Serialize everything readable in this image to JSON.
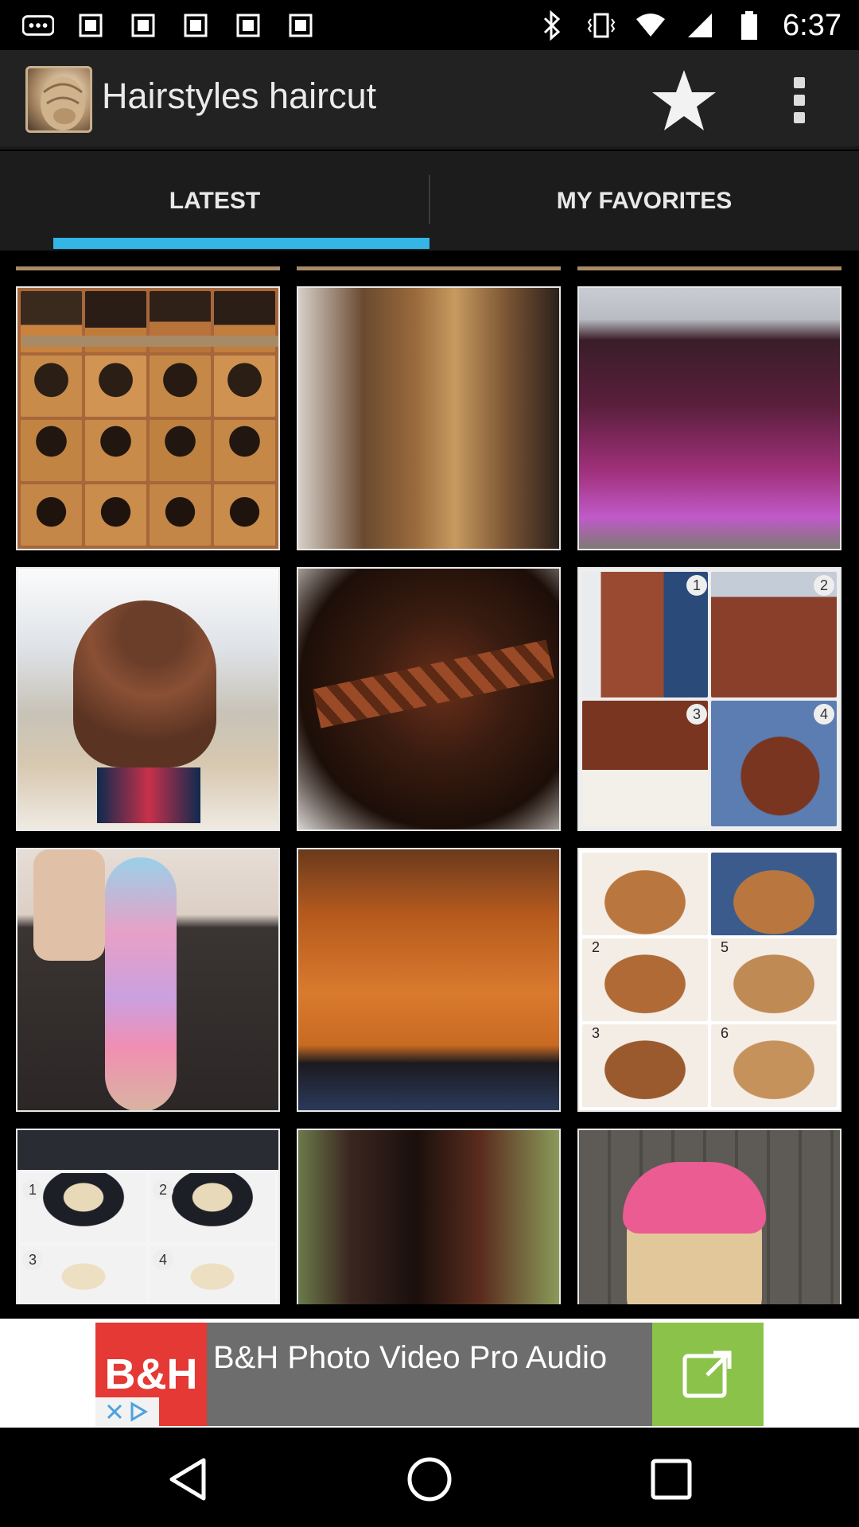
{
  "status_bar": {
    "time": "6:37",
    "left_icons": [
      "more-notifications-icon",
      "image-icon",
      "image-icon",
      "image-icon",
      "image-icon",
      "image-icon"
    ],
    "right_icons": [
      "bluetooth-icon",
      "vibrate-icon",
      "wifi-icon",
      "signal-icon",
      "battery-icon"
    ]
  },
  "app_bar": {
    "title": "Hairstyles haircut",
    "logo_icon": "hair-bun-logo",
    "actions": [
      "star-icon",
      "overflow-menu-icon"
    ]
  },
  "tabs": [
    {
      "label": "LATEST",
      "selected": true
    },
    {
      "label": "MY FAVORITES",
      "selected": false
    }
  ],
  "accent_color": "#33b5e5",
  "grid": {
    "columns": 3,
    "tiles": [
      {
        "id": "tutorial-collage-bun"
      },
      {
        "id": "wavy-brown-ombre"
      },
      {
        "id": "purple-ombre-curls"
      },
      {
        "id": "braided-top-bun"
      },
      {
        "id": "side-braid-closeup"
      },
      {
        "id": "braid-bun-steps"
      },
      {
        "id": "rainbow-fishtail-braid"
      },
      {
        "id": "copper-straight-hair"
      },
      {
        "id": "half-up-bow-steps"
      },
      {
        "id": "blonde-steps"
      },
      {
        "id": "dark-brown-ombre"
      },
      {
        "id": "pink-lace-headband"
      }
    ],
    "step_numbers": {
      "braid_bun": [
        "1",
        "2",
        "3",
        "4"
      ],
      "half_up": [
        "2",
        "5",
        "3",
        "6"
      ],
      "blonde": [
        "1",
        "2",
        "3",
        "4"
      ]
    }
  },
  "ad": {
    "brand": "B&H",
    "text": "B&H Photo Video Pro Audio",
    "open_icon": "open-external-icon",
    "adchoices_icons": [
      "close-icon",
      "adchoices-icon"
    ]
  },
  "nav_bar": {
    "buttons": [
      "back-icon",
      "home-icon",
      "recents-icon"
    ]
  }
}
